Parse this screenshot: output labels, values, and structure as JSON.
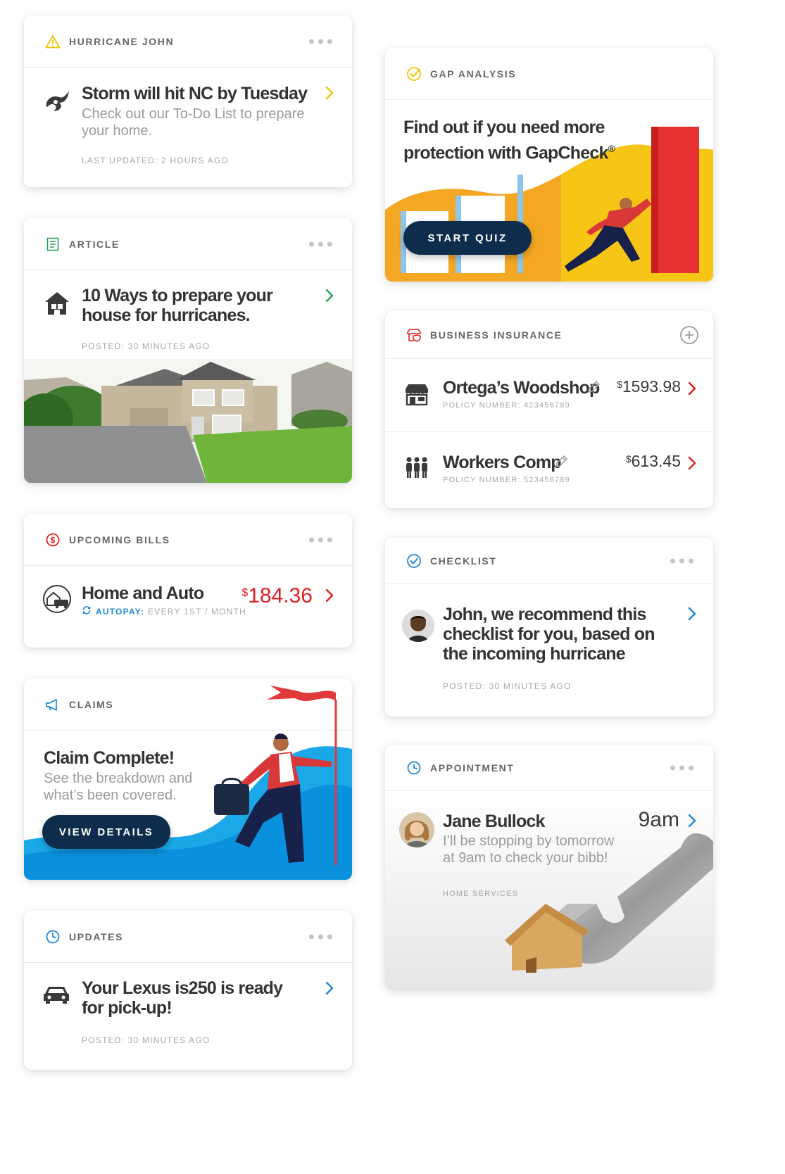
{
  "hurricane": {
    "header": "HURRICANE JOHN",
    "title": "Storm will hit NC by Tuesday",
    "body_line1": "Check out our To-Do List to prepare",
    "body_line2": "your home.",
    "meta": "LAST UPDATED: 2 HOURS AGO"
  },
  "article": {
    "header": "ARTICLE",
    "title_line1": "10 Ways to prepare your",
    "title_line2": "house for hurricanes.",
    "meta": "POSTED: 30 MINUTES AGO"
  },
  "bills": {
    "header": "UPCOMING BILLS",
    "title": "Home and Auto",
    "autopay_label": "AUTOPAY:",
    "autopay_detail": "EVERY 1ST / MONTH",
    "currency": "$",
    "amount": "184.36"
  },
  "claims": {
    "header": "CLAIMS",
    "title": "Claim Complete!",
    "body_line1": "See the breakdown and",
    "body_line2": "what’s been covered.",
    "button": "VIEW DETAILS"
  },
  "updates": {
    "header": "UPDATES",
    "title_line1": "Your Lexus is250 is ready",
    "title_line2": "for pick-up!",
    "meta": "POSTED: 30 MINUTES AGO"
  },
  "gap": {
    "header": "GAP ANALYSIS",
    "title_line1": "Find out if you need more",
    "title_line2": "protection with GapCheck",
    "title_mark": "®",
    "button": "START QUIZ"
  },
  "business": {
    "header": "BUSINESS INSURANCE",
    "policies": [
      {
        "name": "Ortega’s Woodshop",
        "policy": "POLICY NUMBER: 423456789",
        "currency": "$",
        "amount": "1593.98"
      },
      {
        "name": "Workers Comp",
        "policy": "POLICY NUMBER: 523456789",
        "currency": "$",
        "amount": "613.45"
      }
    ]
  },
  "checklist": {
    "header": "CHECKLIST",
    "line1": "John, we recommend this",
    "line2": "checklist for you, based on",
    "line3": "the incoming hurricane",
    "meta": "POSTED: 30 MINUTES AGO"
  },
  "appointment": {
    "header": "APPOINTMENT",
    "name": "Jane Bullock",
    "time": "9am",
    "body_line1": "I’ll be stopping by tomorrow",
    "body_line2": "at 9am to check your bibb!",
    "meta": "HOME SERVICES"
  },
  "colors": {
    "warning": "#f2c200",
    "green": "#2e9e5b",
    "red": "#e02020",
    "blue": "#1e88d6",
    "navy": "#0e2c4b",
    "yellow": "#f6bf14"
  }
}
